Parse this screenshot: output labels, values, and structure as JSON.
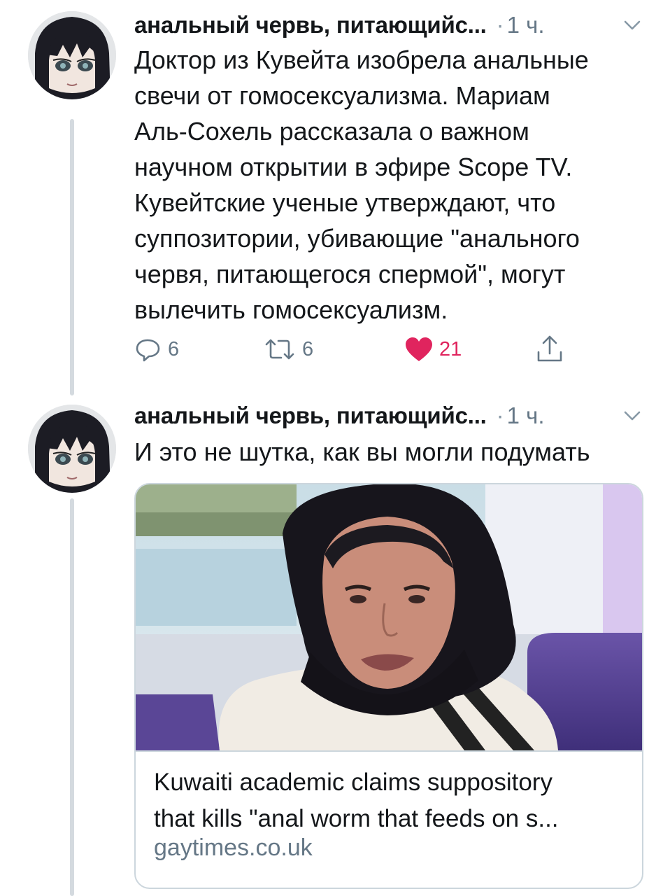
{
  "tweets": [
    {
      "author_name": "анальный червь, питающийс...",
      "separator": "·",
      "time": "1 ч.",
      "text": "Доктор из Кувейта изобрела анальные\nсвечи от гомосексуализма. Мариам\nАль-Сохель рассказала о важном\nнаучном открытии в эфире Scope TV.\nКувейтские ученые утверждают, что\nсуппозитории, убивающие \"анального\nчервя, питающегося спермой\", могут\nвылечить гомосексуализм.",
      "actions": {
        "replies": "6",
        "retweets": "6",
        "likes": "21"
      }
    },
    {
      "author_name": "анальный червь, питающийс...",
      "separator": "·",
      "time": "1 ч.",
      "text": "И это не шутка, как вы могли подумать",
      "card": {
        "title": "Kuwaiti academic claims suppository\nthat kills \"anal worm that feeds on s...",
        "domain": "gaytimes.co.uk"
      }
    }
  ],
  "colors": {
    "text": "#14171a",
    "secondary": "#657786",
    "like": "#e0245e",
    "thread_line": "#d4dadf",
    "border": "#ccd6dd"
  },
  "icons": [
    "reply-icon",
    "retweet-icon",
    "like-icon",
    "share-icon",
    "chevron-down-icon"
  ]
}
